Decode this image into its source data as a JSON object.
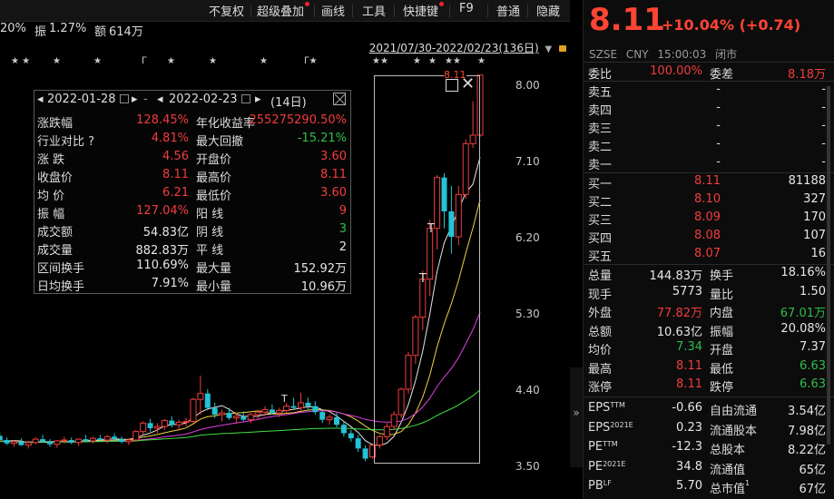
{
  "toolbar": {
    "items": [
      "不复权",
      "超级叠加",
      "画线",
      "工具",
      "快捷键",
      "F9",
      "普通",
      "隐藏"
    ]
  },
  "info_bar": {
    "pct_text": "20%",
    "amplitude_label": "振",
    "amplitude_value": "1.27%",
    "amount_label": "额",
    "amount_value": "614万"
  },
  "range": {
    "text": "2021/07/30-2022/02/23(136日)"
  },
  "y_axis": [
    "8.00",
    "7.10",
    "6.20",
    "5.30",
    "4.40",
    "3.50"
  ],
  "stat_popup": {
    "start_date": "2022-01-28",
    "end_date": "2022-02-23",
    "days": "(14日)",
    "rows": [
      {
        "l1": "涨跌幅",
        "v1": "128.45%",
        "l2": "年化收益率",
        "v2": "255275290.50%"
      },
      {
        "l1": "行业对比 ?",
        "v1": "4.81%",
        "l2": "最大回撤",
        "v2": "-15.21%"
      },
      {
        "l1": "涨  跌",
        "v1": "4.56",
        "l2": "开盘价",
        "v2": "3.60"
      },
      {
        "l1": "收盘价",
        "v1": "8.11",
        "l2": "最高价",
        "v2": "8.11"
      },
      {
        "l1": "均  价",
        "v1": "6.21",
        "l2": "最低价",
        "v2": "3.60"
      },
      {
        "l1": "振  幅",
        "v1": "127.04%",
        "l2": "阳  线",
        "v2": "9"
      },
      {
        "l1": "成交额",
        "v1": "54.83亿",
        "l2": "阴  线",
        "v2": "3"
      },
      {
        "l1": "成交量",
        "v1": "882.83万",
        "l2": "平  线",
        "v2": "2"
      },
      {
        "l1": "区间换手",
        "v1": "110.69%",
        "l2": "最大量",
        "v2": "152.92万"
      },
      {
        "l1": "日均换手",
        "v1": "7.91%",
        "l2": "最小量",
        "v2": "10.96万"
      }
    ]
  },
  "chart_data": {
    "type": "candlestick",
    "ylim": [
      3.3,
      8.2
    ],
    "y_ticks": [
      8.0,
      7.1,
      6.2,
      5.3,
      4.4,
      3.5
    ],
    "candles": [
      [
        3.78,
        3.82,
        3.74,
        3.79
      ],
      [
        3.8,
        3.84,
        3.75,
        3.77
      ],
      [
        3.77,
        3.8,
        3.72,
        3.74
      ],
      [
        3.74,
        3.79,
        3.7,
        3.77
      ],
      [
        3.77,
        3.88,
        3.75,
        3.86
      ],
      [
        3.85,
        3.9,
        3.78,
        3.8
      ],
      [
        3.8,
        3.83,
        3.74,
        3.76
      ],
      [
        3.76,
        3.8,
        3.72,
        3.78
      ],
      [
        3.78,
        3.82,
        3.73,
        3.74
      ],
      [
        3.74,
        3.79,
        3.7,
        3.77
      ],
      [
        3.77,
        3.83,
        3.75,
        3.81
      ],
      [
        3.81,
        3.86,
        3.77,
        3.78
      ],
      [
        3.78,
        3.81,
        3.72,
        3.75
      ],
      [
        3.75,
        3.8,
        3.71,
        3.79
      ],
      [
        3.79,
        3.84,
        3.76,
        3.8
      ],
      [
        3.8,
        3.83,
        3.75,
        3.77
      ],
      [
        3.77,
        3.82,
        3.73,
        3.81
      ],
      [
        3.81,
        3.86,
        3.78,
        3.79
      ],
      [
        3.79,
        3.84,
        3.76,
        3.82
      ],
      [
        3.82,
        3.86,
        3.78,
        3.8
      ],
      [
        3.8,
        3.86,
        3.76,
        3.84
      ],
      [
        3.84,
        3.88,
        3.79,
        3.81
      ],
      [
        3.81,
        3.84,
        3.76,
        3.78
      ],
      [
        3.78,
        3.82,
        3.74,
        3.8
      ],
      [
        3.8,
        3.92,
        3.78,
        3.9
      ],
      [
        3.9,
        4.02,
        3.86,
        4.0
      ],
      [
        4.0,
        4.05,
        3.9,
        3.94
      ],
      [
        3.94,
        4.0,
        3.88,
        3.96
      ],
      [
        3.96,
        4.05,
        3.92,
        4.03
      ],
      [
        4.03,
        4.08,
        3.95,
        3.98
      ],
      [
        3.98,
        4.04,
        3.92,
        4.01
      ],
      [
        4.01,
        4.06,
        3.96,
        4.02
      ],
      [
        4.02,
        4.3,
        4.0,
        4.28
      ],
      [
        4.28,
        4.56,
        4.1,
        4.35
      ],
      [
        4.35,
        4.4,
        4.15,
        4.18
      ],
      [
        4.18,
        4.24,
        4.06,
        4.1
      ],
      [
        4.1,
        4.16,
        4.02,
        4.12
      ],
      [
        4.12,
        4.18,
        4.04,
        4.06
      ],
      [
        4.06,
        4.12,
        3.99,
        4.08
      ],
      [
        4.08,
        4.14,
        4.02,
        4.04
      ],
      [
        4.04,
        4.12,
        4.0,
        4.1
      ],
      [
        4.1,
        4.15,
        4.04,
        4.13
      ],
      [
        4.13,
        4.2,
        4.08,
        4.16
      ],
      [
        4.16,
        4.22,
        4.1,
        4.12
      ],
      [
        4.12,
        4.18,
        4.07,
        4.15
      ],
      [
        4.15,
        4.24,
        4.12,
        4.2
      ],
      [
        4.2,
        4.3,
        4.16,
        4.18
      ],
      [
        4.18,
        4.36,
        4.15,
        4.24
      ],
      [
        4.24,
        4.3,
        4.15,
        4.2
      ],
      [
        4.2,
        4.26,
        4.1,
        4.13
      ],
      [
        4.13,
        4.16,
        4.0,
        4.04
      ],
      [
        4.04,
        4.1,
        3.98,
        4.07
      ],
      [
        4.07,
        4.12,
        3.95,
        3.98
      ],
      [
        3.98,
        4.02,
        3.84,
        3.88
      ],
      [
        3.88,
        3.92,
        3.78,
        3.82
      ],
      [
        3.82,
        3.86,
        3.66,
        3.7
      ],
      [
        3.7,
        3.74,
        3.55,
        3.58
      ],
      [
        3.6,
        3.76,
        3.58,
        3.74
      ],
      [
        3.74,
        3.86,
        3.7,
        3.84
      ],
      [
        3.84,
        4.0,
        3.8,
        3.96
      ],
      [
        3.96,
        4.14,
        3.92,
        4.1
      ],
      [
        4.1,
        4.42,
        4.06,
        4.4
      ],
      [
        4.4,
        4.84,
        4.35,
        4.8
      ],
      [
        4.8,
        5.28,
        4.7,
        5.25
      ],
      [
        5.25,
        5.8,
        5.1,
        5.7
      ],
      [
        5.7,
        6.4,
        5.5,
        6.3
      ],
      [
        6.3,
        6.93,
        6.05,
        6.9
      ],
      [
        6.9,
        6.95,
        6.3,
        6.5
      ],
      [
        6.5,
        6.8,
        6.0,
        6.2
      ],
      [
        6.2,
        6.8,
        6.1,
        6.7
      ],
      [
        6.7,
        7.35,
        6.65,
        7.3
      ],
      [
        7.3,
        7.8,
        7.25,
        7.4
      ],
      [
        7.4,
        8.11,
        7.38,
        8.11
      ]
    ],
    "ma_series": [
      {
        "color": "#e6e6e6"
      },
      {
        "color": "#f0d23c"
      },
      {
        "color": "#e040e0"
      },
      {
        "color": "#40e040"
      }
    ]
  },
  "chart_marks": {
    "t_marks": [
      "T",
      "T",
      "T"
    ],
    "cursor_price": "8.11"
  },
  "quote": {
    "price": "8.11",
    "change": "+10.04% (+0.74)",
    "exchange": "SZSE",
    "currency": "CNY",
    "time": "15:00:03",
    "status": "闭市",
    "wei_bi_label": "委比",
    "wei_bi_value": "100.00%",
    "wei_cha_label": "委差",
    "wei_cha_value": "8.18万",
    "asks": [
      {
        "label": "卖五",
        "price": "-",
        "vol": "-"
      },
      {
        "label": "卖四",
        "price": "-",
        "vol": "-"
      },
      {
        "label": "卖三",
        "price": "-",
        "vol": "-"
      },
      {
        "label": "卖二",
        "price": "-",
        "vol": "-"
      },
      {
        "label": "卖一",
        "price": "-",
        "vol": "-"
      }
    ],
    "bids": [
      {
        "label": "买一",
        "price": "8.11",
        "vol": "81188"
      },
      {
        "label": "买二",
        "price": "8.10",
        "vol": "327"
      },
      {
        "label": "买三",
        "price": "8.09",
        "vol": "170"
      },
      {
        "label": "买四",
        "price": "8.08",
        "vol": "107"
      },
      {
        "label": "买五",
        "price": "8.07",
        "vol": "16"
      }
    ],
    "stats": [
      {
        "l1": "总量",
        "v1": "144.83万",
        "c1": "white",
        "l2": "换手",
        "v2": "18.16%",
        "c2": "white"
      },
      {
        "l1": "现手",
        "v1": "5773",
        "c1": "white",
        "l2": "量比",
        "v2": "1.50",
        "c2": "white"
      },
      {
        "l1": "外盘",
        "v1": "77.82万",
        "c1": "red",
        "l2": "内盘",
        "v2": "67.01万",
        "c2": "green"
      },
      {
        "l1": "总额",
        "v1": "10.63亿",
        "c1": "white",
        "l2": "振幅",
        "v2": "20.08%",
        "c2": "white"
      },
      {
        "l1": "均价",
        "v1": "7.34",
        "c1": "green",
        "l2": "开盘",
        "v2": "7.37",
        "c2": "white"
      },
      {
        "l1": "最高",
        "v1": "8.11",
        "c1": "red",
        "l2": "最低",
        "v2": "6.63",
        "c2": "green"
      },
      {
        "l1": "涨停",
        "v1": "8.11",
        "c1": "red",
        "l2": "跌停",
        "v2": "6.63",
        "c2": "green"
      }
    ],
    "fundamentals": [
      {
        "l1": "EPS",
        "s1": "TTM",
        "v1": "-0.66",
        "l2": "自由流通",
        "v2": "3.54亿"
      },
      {
        "l1": "EPS",
        "s1": "2021E",
        "v1": "0.23",
        "l2": "流通股本",
        "v2": "7.98亿"
      },
      {
        "l1": "PE",
        "s1": "TTM",
        "v1": "-12.3",
        "l2": "总股本",
        "v2": "8.22亿"
      },
      {
        "l1": "PE",
        "s1": "2021E",
        "v1": "34.8",
        "l2": "流通值",
        "v2": "65亿"
      },
      {
        "l1": "PB",
        "s1": "LF",
        "v1": "5.70",
        "l2": "总市值",
        "s2": "1",
        "v2": "67亿"
      }
    ]
  },
  "collapse_glyph": "»"
}
